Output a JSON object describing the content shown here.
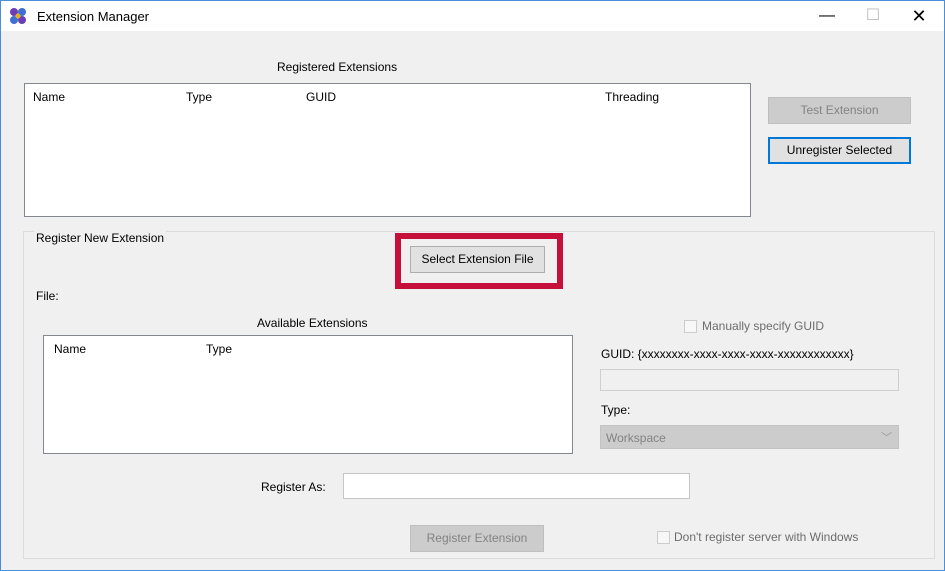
{
  "window": {
    "title": "Extension Manager",
    "minimize": "—",
    "maximize": "☐",
    "close": "✕"
  },
  "registered": {
    "title": "Registered Extensions",
    "columns": [
      "Name",
      "Type",
      "GUID",
      "Threading"
    ],
    "rows": []
  },
  "buttons": {
    "test_extension": "Test Extension",
    "unregister_selected": "Unregister Selected",
    "select_file": "Select Extension File",
    "register_extension": "Register Extension"
  },
  "register_new": {
    "group_title": "Register New Extension",
    "file_label": "File:",
    "available_title": "Available Extensions",
    "available_columns": [
      "Name",
      "Type"
    ],
    "manual_guid_label": "Manually specify GUID",
    "guid_label": "GUID: {xxxxxxxx-xxxx-xxxx-xxxx-xxxxxxxxxxxx}",
    "guid_value": "",
    "type_label": "Type:",
    "type_value": "Workspace",
    "register_as_label": "Register As:",
    "register_as_value": "",
    "dont_register_label": "Don't register server with Windows"
  },
  "colors": {
    "highlight": "#c4103b",
    "focus_border": "#0078d7"
  }
}
